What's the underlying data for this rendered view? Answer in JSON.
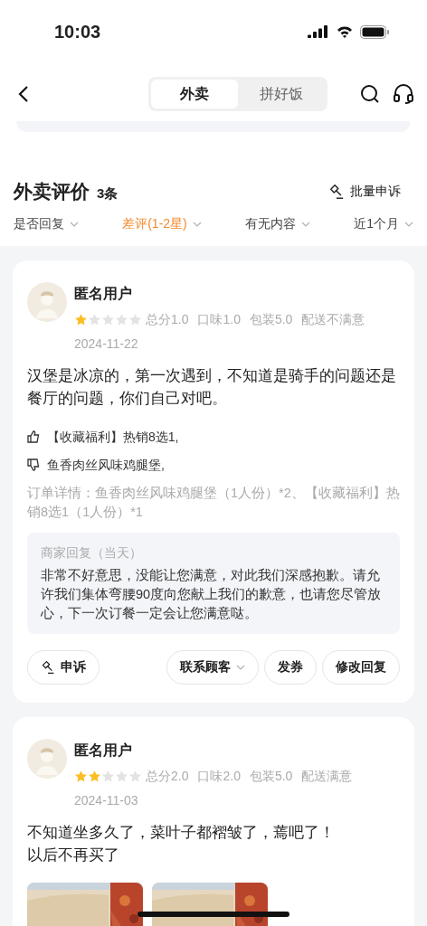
{
  "status_bar": {
    "time": "10:03"
  },
  "nav": {
    "tabs": [
      {
        "label": "外卖",
        "selected": true
      },
      {
        "label": "拼好饭",
        "selected": false
      }
    ]
  },
  "section": {
    "title": "外卖评价",
    "count": "3条",
    "batch_action": "批量申诉"
  },
  "filters": [
    {
      "label": "是否回复",
      "selected": false
    },
    {
      "label": "差评(1-2星)",
      "selected": true
    },
    {
      "label": "有无内容",
      "selected": false
    },
    {
      "label": "近1个月",
      "selected": false
    }
  ],
  "reviews": [
    {
      "user": "匿名用户",
      "stars": 1,
      "scores": [
        "总分1.0",
        "口味1.0",
        "包装5.0",
        "配送不满意"
      ],
      "date": "2024-11-22",
      "text": "汉堡是冰凉的，第一次遇到，不知道是骑手的问题还是餐厅的问题，你们自己对吧。",
      "liked": "【收藏福利】热销8选1,",
      "disliked": "鱼香肉丝风味鸡腿堡,",
      "order_detail": "订单详情：鱼香肉丝风味鸡腿堡（1人份）*2、【收藏福利】热销8选1（1人份）*1",
      "reply": {
        "title": "商家回复（当天）",
        "text": "非常不好意思，没能让您满意，对此我们深感抱歉。请允许我们集体弯腰90度向您献上我们的歉意，也请您尽管放心，下一次订餐一定会让您满意哒。"
      },
      "actions": [
        {
          "label": "申诉",
          "kind": "appeal"
        },
        {
          "label": "联系顾客",
          "kind": "dropdown"
        },
        {
          "label": "发券",
          "kind": "plain"
        },
        {
          "label": "修改回复",
          "kind": "plain"
        }
      ]
    },
    {
      "user": "匿名用户",
      "stars": 2,
      "scores": [
        "总分2.0",
        "口味2.0",
        "包装5.0",
        "配送满意"
      ],
      "date": "2024-11-03",
      "text": "不知道坐多久了，菜叶子都褶皱了，蔫吧了！",
      "text_2": "以后不再买了",
      "photos": [
        {
          "kind": "picture"
        },
        {
          "kind": "picture"
        }
      ]
    }
  ]
}
